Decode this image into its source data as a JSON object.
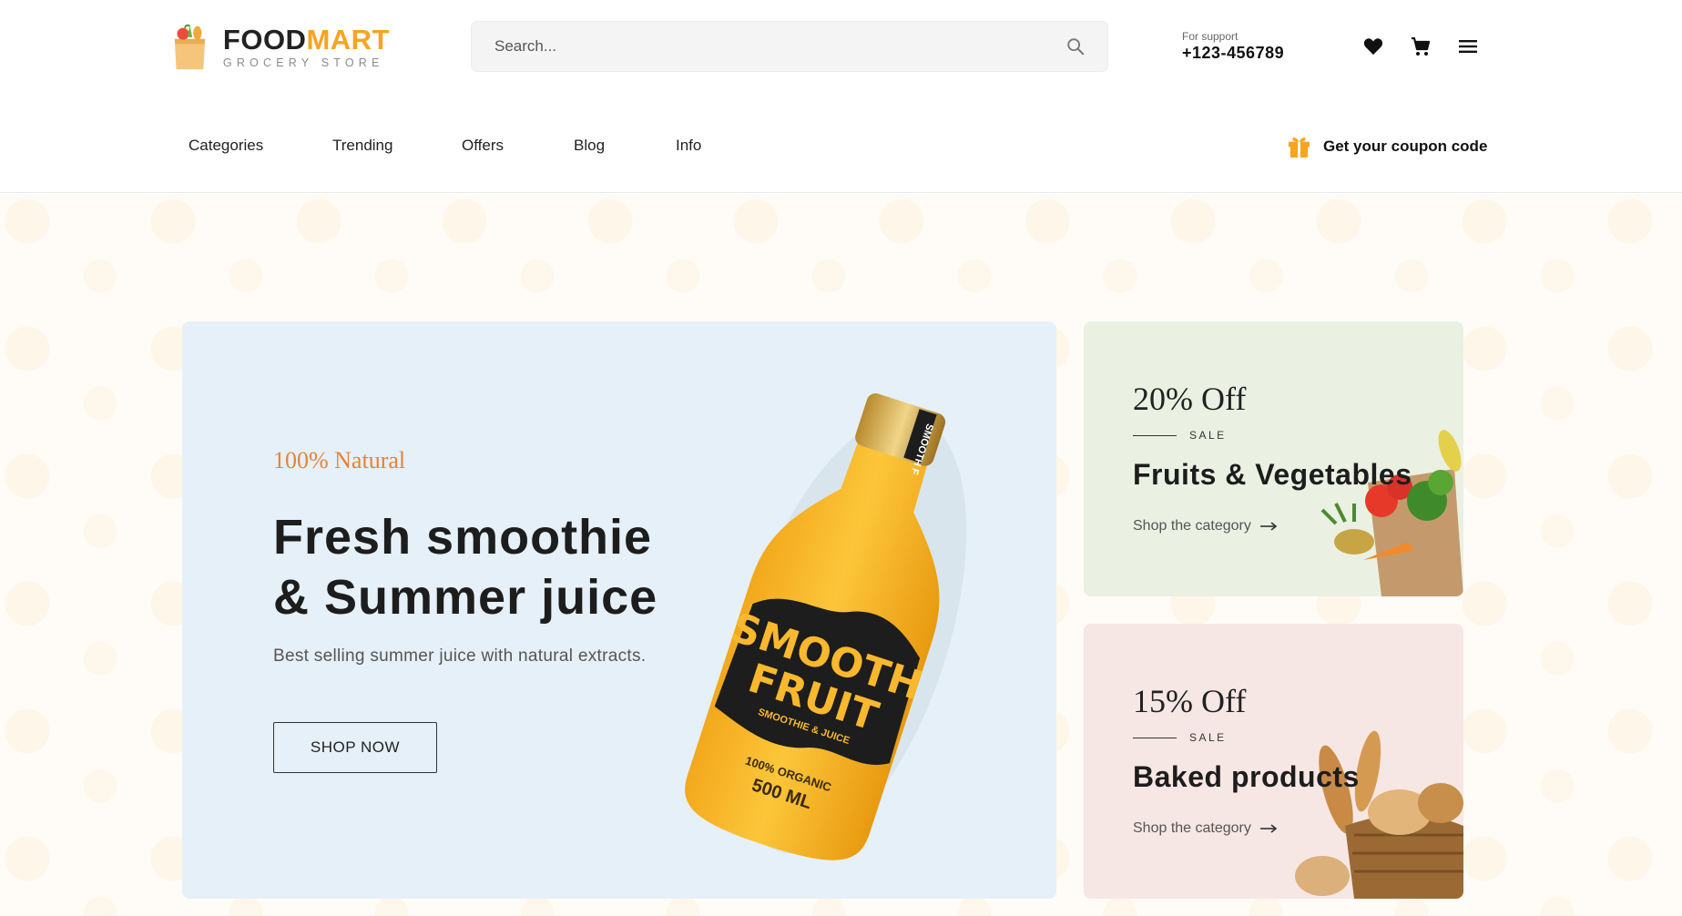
{
  "brand": {
    "name_part1": "FOOD",
    "name_part2": "MART",
    "tagline": "GROCERY STORE",
    "accent_color": "#f7a422"
  },
  "search": {
    "placeholder": "Search...",
    "icon": "search-icon"
  },
  "support": {
    "label": "For support",
    "phone": "+123-456789"
  },
  "header_icons": [
    "heart-icon",
    "cart-icon",
    "menu-icon"
  ],
  "nav": {
    "items": [
      {
        "label": "Categories"
      },
      {
        "label": "Trending"
      },
      {
        "label": "Offers"
      },
      {
        "label": "Blog"
      },
      {
        "label": "Info"
      }
    ],
    "coupon": {
      "label": "Get your coupon code",
      "icon": "gift-icon"
    }
  },
  "hero": {
    "tag": "100% Natural",
    "title_line1": "Fresh smoothie",
    "title_line2": "& Summer juice",
    "description": "Best selling summer juice with natural extracts.",
    "button_label": "SHOP NOW",
    "background": "#e6f0f8",
    "product": {
      "label_line1": "SMOOTH",
      "label_line2": "FRUIT",
      "label_sub": "SMOOTHIE & JUICE",
      "organic": "100% ORGANIC",
      "volume": "500 ML",
      "cap_text": "SMOOTH F"
    }
  },
  "promos": [
    {
      "discount": "20% Off",
      "sale": "SALE",
      "title": "Fruits & Vegetables",
      "link": "Shop the category",
      "background": "#eaf1e2"
    },
    {
      "discount": "15% Off",
      "sale": "SALE",
      "title": "Baked products",
      "link": "Shop the category",
      "background": "#f7e7e4"
    }
  ]
}
